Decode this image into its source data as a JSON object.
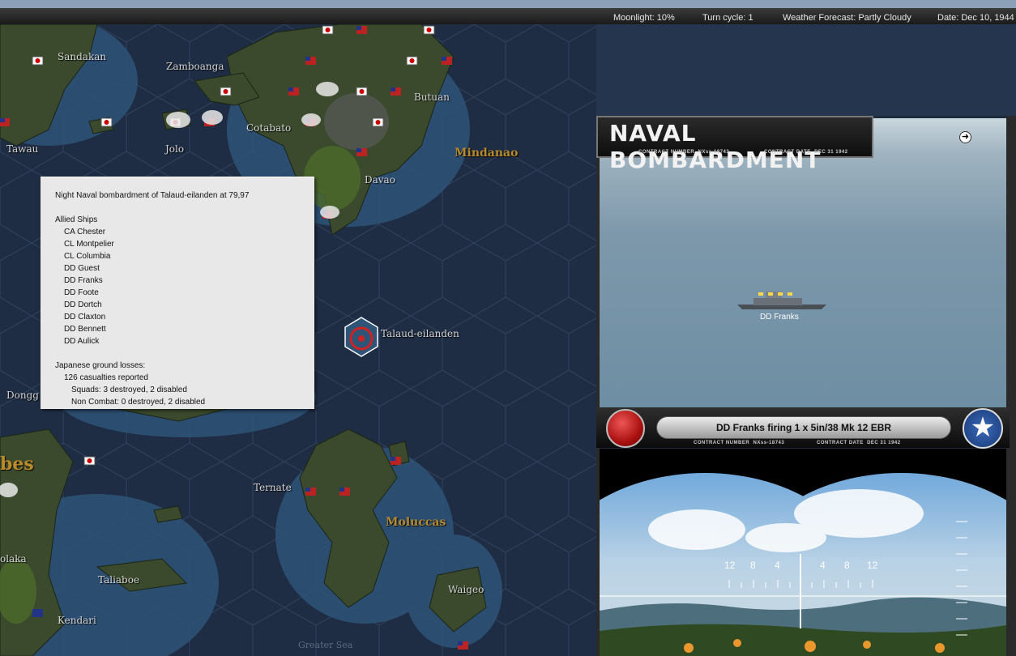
{
  "topbar": {
    "moonlight": "Moonlight: 10%",
    "turn_cycle": "Turn cycle: 1",
    "weather": "Weather Forecast: Partly Cloudy",
    "date": "Date: Dec 10, 1944"
  },
  "map": {
    "places": [
      "Sandakan",
      "Zamboanga",
      "Butuan",
      "Cotabato",
      "Tawau",
      "Jolo",
      "Davao",
      "Talaud-eilanden",
      "Dongg",
      "Ternate",
      "Taliaboe",
      "Waigeo",
      "Kendari",
      "olaka"
    ],
    "regions": [
      "Mindanao",
      "Moluccas",
      "bes"
    ],
    "watermark": "Greater Sea"
  },
  "report": {
    "title": "Night Naval bombardment of Talaud-eilanden at 79,97",
    "allied_header": "Allied Ships",
    "ships": [
      "CA Chester",
      "CL Montpelier",
      "CL Columbia",
      "DD Guest",
      "DD Franks",
      "DD Foote",
      "DD Dortch",
      "DD Claxton",
      "DD Bennett",
      "DD Aulick"
    ],
    "losses_header": "Japanese ground losses:",
    "casualties": "126 casualties reported",
    "squads": "Squads: 3 destroyed, 2 disabled",
    "non_combat": "Non Combat: 0 destroyed, 2 disabled"
  },
  "combat": {
    "title": "NAVAL BOMBARDMENT",
    "contract_number_label": "CONTRACT NUMBER",
    "contract_number": "NXss-18743",
    "contract_date_label": "CONTRACT DATE",
    "contract_date": "DEC 31 1942",
    "ship_label": "DD Franks",
    "fire_text": "DD Franks firing 1 x 5in/38 Mk 12 EBR",
    "scope_ticks": [
      "12",
      "8",
      "4",
      "4",
      "8",
      "12"
    ],
    "next_icon": "arrow-right-icon",
    "japan_icon": "red-disc-icon",
    "allied_icon": "white-star-icon"
  },
  "colors": {
    "sea": "#23324a",
    "land": "#3d4a2a",
    "region_label": "#b88a2a",
    "report_bg": "#e8e8e8"
  }
}
